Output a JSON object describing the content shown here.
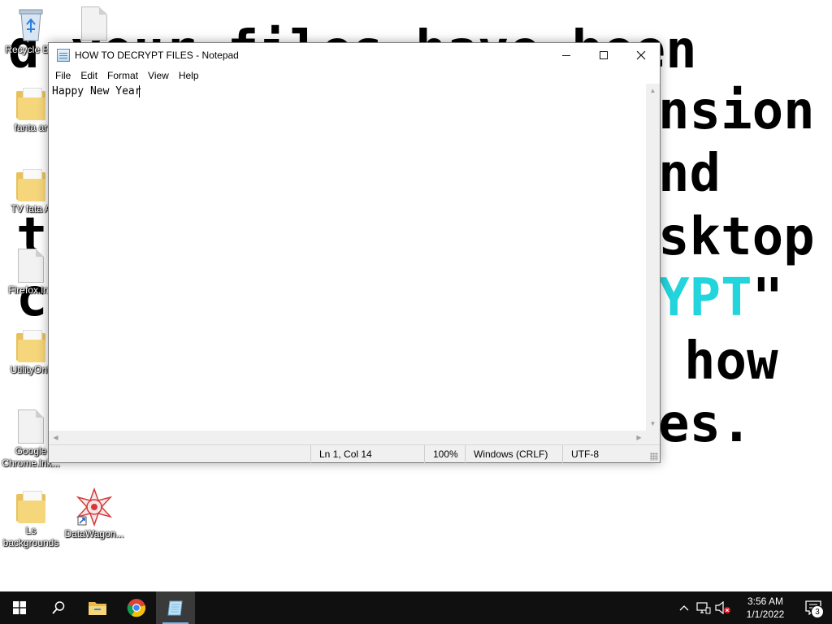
{
  "wallpaper": {
    "line1": "d  your files have been",
    "line2": "nsion",
    "line3": "nd",
    "line4": "t",
    "line4b": "sktop",
    "line5": "c",
    "line5_cyan": "YPT",
    "line5_tail": "\"",
    "line6": "how",
    "line7": "es."
  },
  "desktop_icons": [
    {
      "label": "Recycle Bin",
      "icon": "recycle-bin-icon"
    },
    {
      "label": "fanta ar",
      "icon": "folder-icon"
    },
    {
      "label": "TV fata A",
      "icon": "folder-icon"
    },
    {
      "label": "Firefox.lnk",
      "icon": "file-icon"
    },
    {
      "label": "UtilityOnli",
      "icon": "folder-icon"
    },
    {
      "label": "Google Chrome.lnk...",
      "icon": "file-icon"
    },
    {
      "label": "Ls backgrounds",
      "icon": "folder-icon"
    },
    {
      "label": "DataWagon...",
      "icon": "datawagon-icon"
    }
  ],
  "notepad": {
    "title": "HOW TO DECRYPT FILES - Notepad",
    "menu": [
      "File",
      "Edit",
      "Format",
      "View",
      "Help"
    ],
    "content": "Happy New Year",
    "status": {
      "position": "Ln 1, Col 14",
      "zoom": "100%",
      "line_ending": "Windows (CRLF)",
      "encoding": "UTF-8"
    }
  },
  "taskbar": {
    "clock_time": "3:56 AM",
    "clock_date": "1/1/2022",
    "notification_count": "3"
  },
  "colors": {
    "taskbar": "#101010",
    "wallpaper_accent": "#22d4dc",
    "folder": "#f6d67a"
  }
}
